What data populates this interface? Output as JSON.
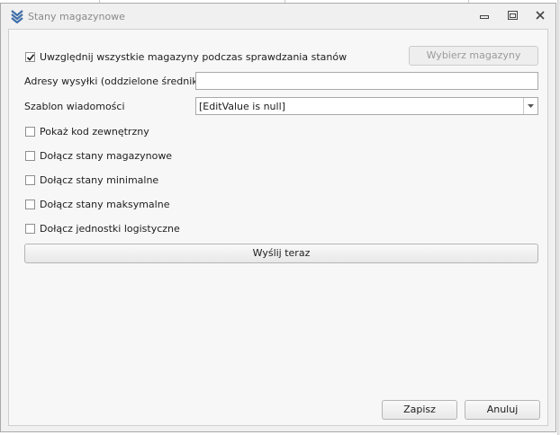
{
  "window": {
    "title": "Stany magazynowe"
  },
  "include_all_warehouses": {
    "label": "Uwzględnij wszystkie magazyny podczas sprawdzania stanów",
    "checked": true
  },
  "choose_warehouses_button": "Wybierz magazyny",
  "shipping_addresses": {
    "label": "Adresy wysyłki (oddzielone średnikiem)",
    "value": ""
  },
  "message_template": {
    "label": "Szablon wiadomości",
    "value": "[EditValue is null]"
  },
  "options": [
    {
      "label": "Pokaż kod zewnętrzny",
      "checked": false
    },
    {
      "label": "Dołącz stany magazynowe",
      "checked": false
    },
    {
      "label": "Dołącz stany minimalne",
      "checked": false
    },
    {
      "label": "Dołącz stany maksymalne",
      "checked": false
    },
    {
      "label": "Dołącz jednostki logistyczne",
      "checked": false
    }
  ],
  "send_now_button": "Wyślij teraz",
  "footer": {
    "save_button": "Zapisz",
    "cancel_button": "Anuluj"
  }
}
